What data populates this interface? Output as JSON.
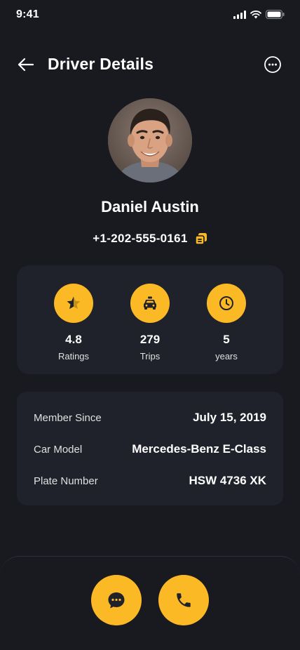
{
  "status_bar": {
    "time": "9:41"
  },
  "header": {
    "title": "Driver Details"
  },
  "driver": {
    "name": "Daniel Austin",
    "phone": "+1-202-555-0161"
  },
  "stats": [
    {
      "icon": "star-half-icon",
      "value": "4.8",
      "label": "Ratings"
    },
    {
      "icon": "taxi-icon",
      "value": "279",
      "label": "Trips"
    },
    {
      "icon": "clock-icon",
      "value": "5",
      "label": "years"
    }
  ],
  "details": [
    {
      "label": "Member Since",
      "value": "July 15, 2019"
    },
    {
      "label": "Car Model",
      "value": "Mercedes-Benz E-Class"
    },
    {
      "label": "Plate Number",
      "value": "HSW 4736 XK"
    }
  ],
  "actions": [
    {
      "icon": "chat-icon"
    },
    {
      "icon": "phone-icon"
    }
  ],
  "colors": {
    "background": "#181a20",
    "card": "#1f222a",
    "accent": "#fbb926",
    "text": "#ffffff"
  }
}
